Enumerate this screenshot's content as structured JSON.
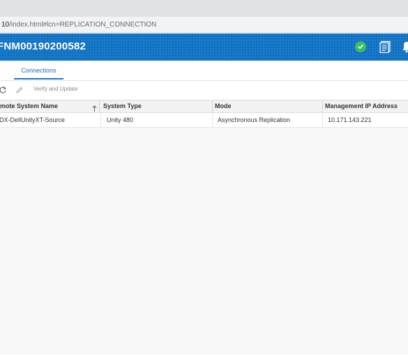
{
  "browser": {
    "url_host": "10",
    "url_path": "/index.html#lcn=REPLICATION_CONNECTION"
  },
  "header": {
    "title": "FNM00190200582",
    "title_prefix": "",
    "icons": [
      "check-circle-icon",
      "logs-icon",
      "bell-icon"
    ],
    "accent_color": "#1172c4",
    "status_color": "#3ebd64"
  },
  "tabs": [
    {
      "label": "Connections",
      "active": true
    }
  ],
  "toolbar": {
    "refresh_icon": "refresh-icon",
    "edit_icon": "pencil-icon",
    "verify_label": "Verify and Update"
  },
  "table": {
    "columns": [
      "mote System Name",
      "System Type",
      "Mode",
      "Management IP Address"
    ],
    "sorted_column_icon": "sort-up-arrow-icon",
    "rows": [
      [
        "DX-DellUnityXT-Source",
        "Unity 480",
        "Asynchronous Replication",
        "10.171.143.221"
      ]
    ]
  }
}
